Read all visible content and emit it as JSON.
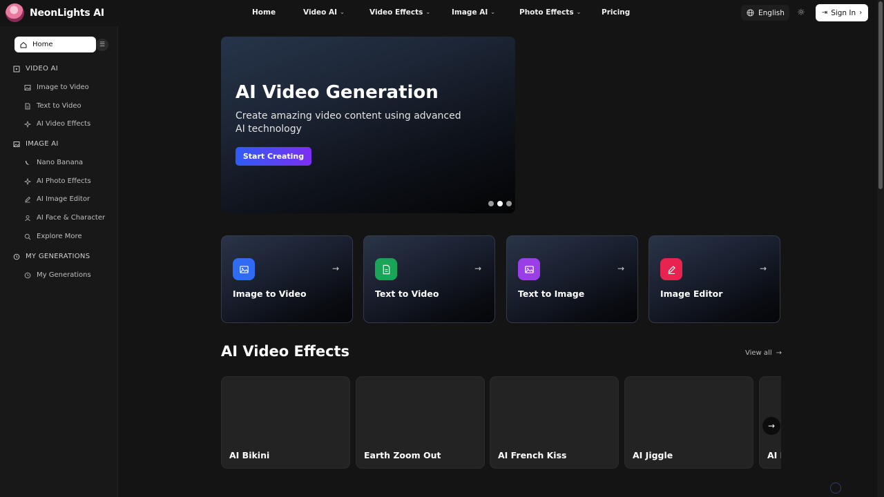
{
  "brand": {
    "name": "NeonLights AI"
  },
  "nav": {
    "items": [
      {
        "label": "Home",
        "has_menu": false
      },
      {
        "label": "Video AI",
        "has_menu": true
      },
      {
        "label": "Video Effects",
        "has_menu": true
      },
      {
        "label": "Image AI",
        "has_menu": true
      },
      {
        "label": "Photo Effects",
        "has_menu": true
      },
      {
        "label": "Pricing",
        "has_menu": false
      }
    ],
    "language": "English",
    "sign_in": "Sign In"
  },
  "sidebar": {
    "home": "Home",
    "sections": [
      {
        "title": "VIDEO AI",
        "icon": "video-square-icon",
        "items": [
          {
            "label": "Image to Video",
            "icon": "image-icon"
          },
          {
            "label": "Text to Video",
            "icon": "document-icon"
          },
          {
            "label": "AI Video Effects",
            "icon": "sparkle-icon"
          }
        ]
      },
      {
        "title": "IMAGE AI",
        "icon": "image-icon",
        "items": [
          {
            "label": "Nano Banana",
            "icon": "banana-icon"
          },
          {
            "label": "AI Photo Effects",
            "icon": "sparkle-icon"
          },
          {
            "label": "AI Image Editor",
            "icon": "pencil-icon"
          },
          {
            "label": "AI Face & Character",
            "icon": "user-icon"
          },
          {
            "label": "Explore More",
            "icon": "search-icon"
          }
        ]
      },
      {
        "title": "MY GENERATIONS",
        "icon": "history-icon",
        "items": [
          {
            "label": "My Generations",
            "icon": "history-icon"
          }
        ]
      }
    ]
  },
  "hero": {
    "title": "AI Video Generation",
    "subtitle": "Create amazing video content using advanced AI technology",
    "cta": "Start Creating",
    "slide_count": 3,
    "active_slide": 2
  },
  "feature_cards": [
    {
      "label": "Image to Video",
      "icon": "image-icon",
      "color": "#2f6bf3"
    },
    {
      "label": "Text to Video",
      "icon": "document-icon",
      "color": "#1aa457"
    },
    {
      "label": "Text to Image",
      "icon": "image-icon",
      "color": "#9a3ee8"
    },
    {
      "label": "Image Editor",
      "icon": "pencil-icon",
      "color": "#e8234f"
    }
  ],
  "effects_section": {
    "title": "AI Video Effects",
    "view_all": "View all",
    "cards": [
      {
        "label": "AI Bikini"
      },
      {
        "label": "Earth Zoom Out"
      },
      {
        "label": "AI French Kiss"
      },
      {
        "label": "AI Jiggle"
      },
      {
        "label": "AI Dance"
      }
    ]
  }
}
